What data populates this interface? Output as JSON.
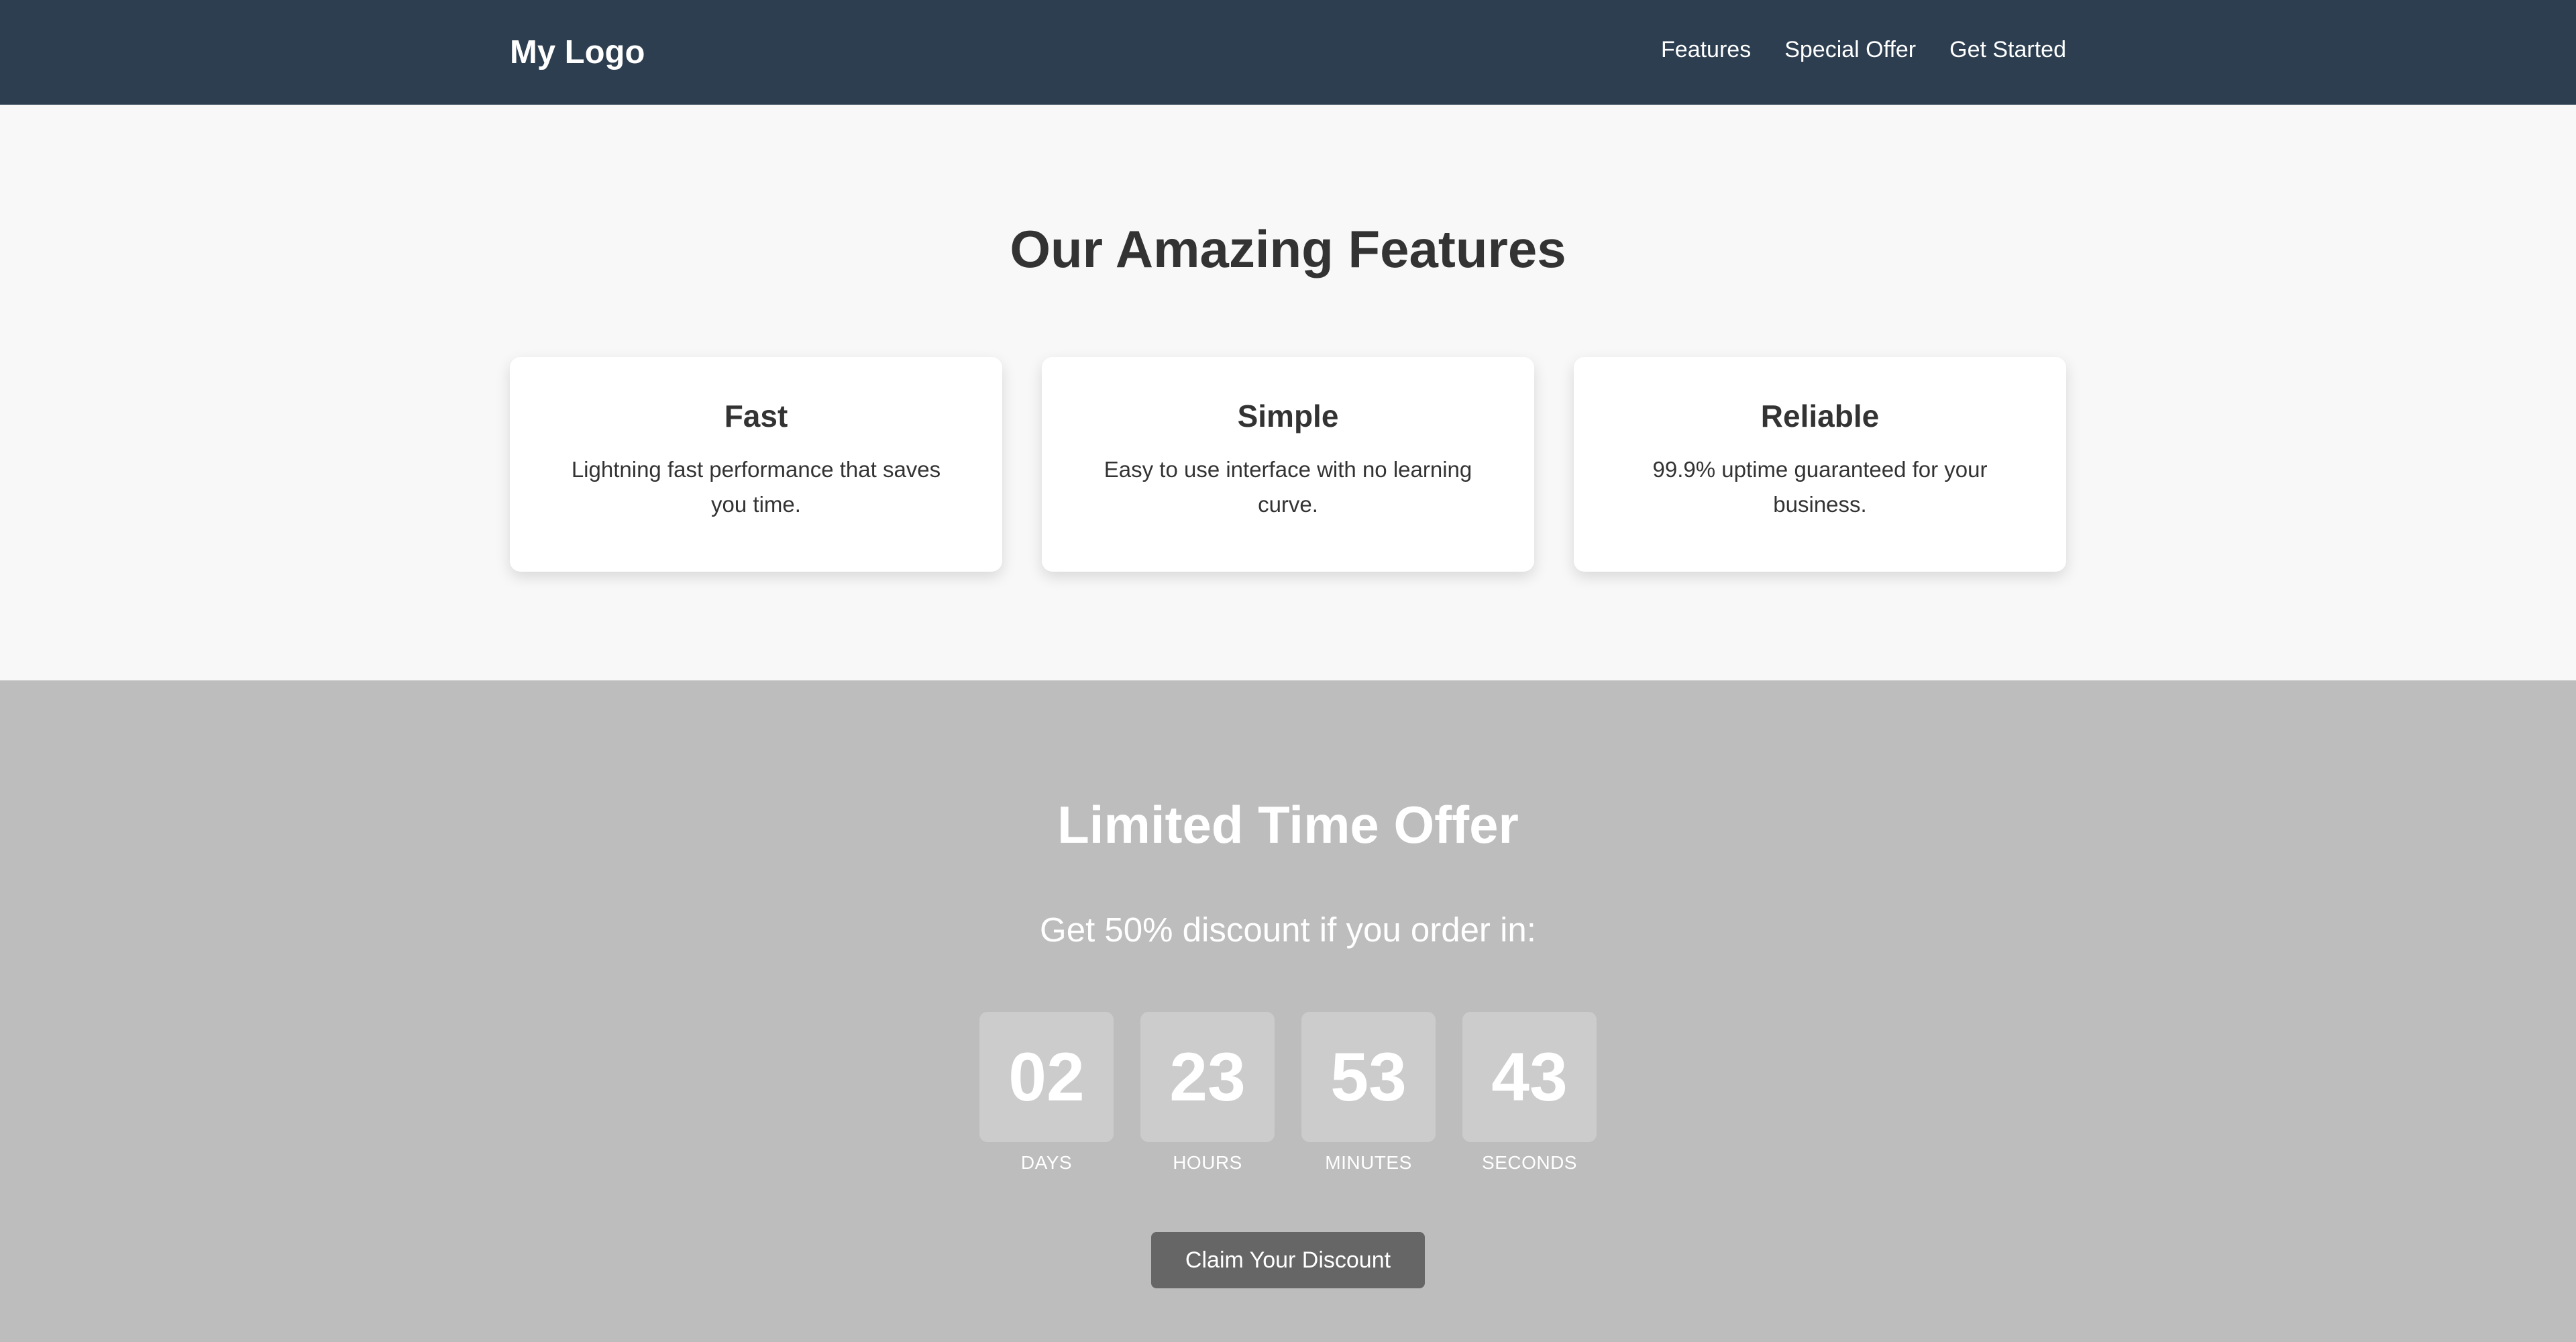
{
  "header": {
    "logo": "My Logo",
    "nav": [
      "Features",
      "Special Offer",
      "Get Started"
    ]
  },
  "features": {
    "title": "Our Amazing Features",
    "cards": [
      {
        "title": "Fast",
        "text": "Lightning fast performance that saves you time."
      },
      {
        "title": "Simple",
        "text": "Easy to use interface with no learning curve."
      },
      {
        "title": "Reliable",
        "text": "99.9% uptime guaranteed for your business."
      }
    ]
  },
  "offer": {
    "title": "Limited Time Offer",
    "subtitle": "Get 50% discount if you order in:",
    "countdown": [
      {
        "value": "02",
        "label": "DAYS"
      },
      {
        "value": "23",
        "label": "HOURS"
      },
      {
        "value": "53",
        "label": "MINUTES"
      },
      {
        "value": "43",
        "label": "SECONDS"
      }
    ],
    "cta": "Claim Your Discount"
  },
  "colors": {
    "header_bg": "#2c3e50",
    "features_bg": "#f8f8f8",
    "offer_bg": "#bdbdbd",
    "countdown_box": "#cccccc",
    "button_bg": "#666666",
    "text_dark": "#333333",
    "text_light": "#ffffff"
  }
}
